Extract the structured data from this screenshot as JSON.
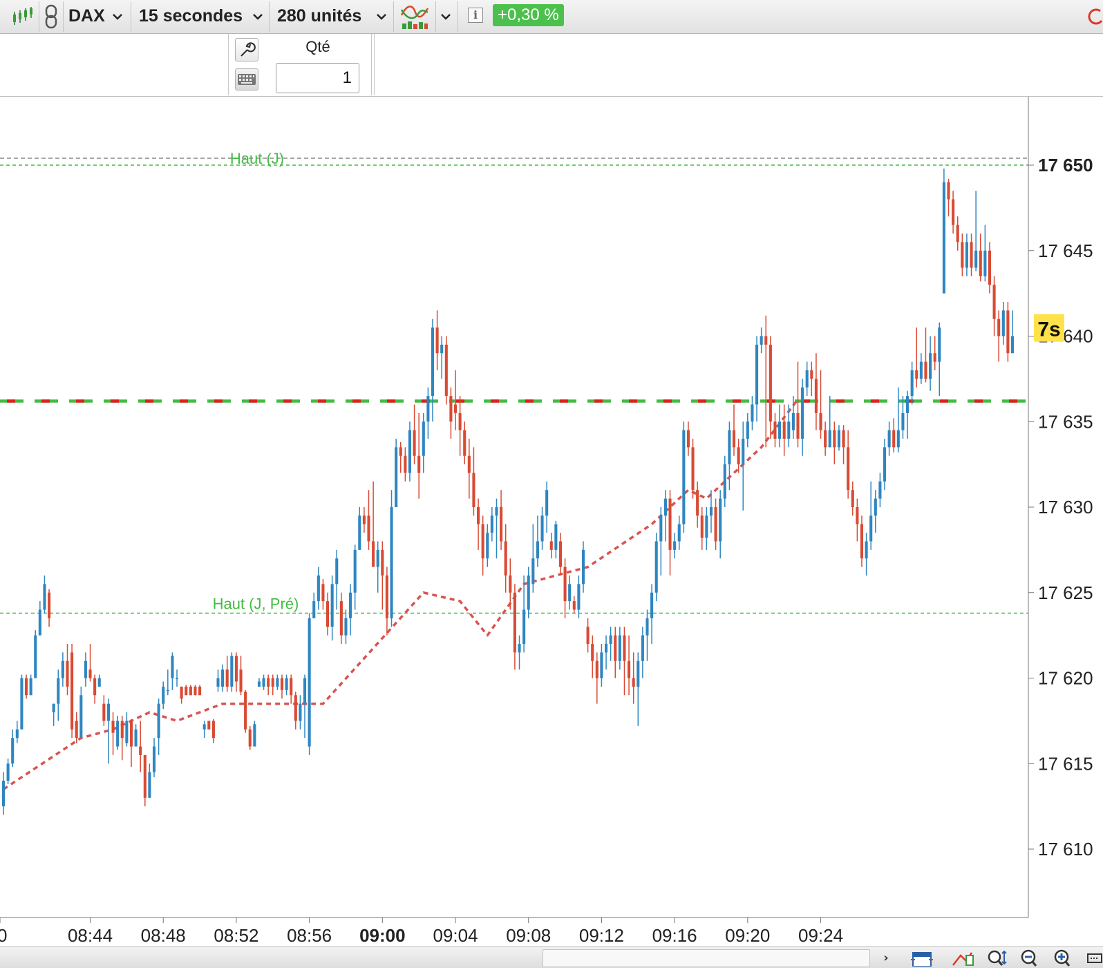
{
  "toolbar": {
    "instrument": "DAX",
    "interval": "15 secondes",
    "units": "280 unités",
    "change_badge": "+0,30 %",
    "badge_color": "#4cc04c"
  },
  "order_panel": {
    "qty_label": "Qté",
    "qty_value": "1"
  },
  "chart": {
    "timer_badge": "7s",
    "hline_labels": {
      "day_high": "Haut (J)",
      "prev_day_high": "Haut (J, Pré)"
    },
    "colors": {
      "up": "#2e86c1",
      "down": "#d94a33",
      "ma": "#d9534f",
      "level_green": "#44bb44",
      "level_red": "#e02020"
    }
  },
  "chart_data": {
    "type": "candlestick",
    "instrument": "DAX",
    "interval": "15 secondes",
    "ylim": [
      17606,
      17654
    ],
    "y_ticks": [
      "17 610",
      "17 615",
      "17 620",
      "17 625",
      "17 630",
      "17 635",
      "17 640",
      "17 645",
      "17 650"
    ],
    "x_ticks": [
      "0",
      "08:44",
      "08:48",
      "08:52",
      "08:56",
      "09:00",
      "09:04",
      "09:08",
      "09:12",
      "09:16",
      "09:20",
      "09:24"
    ],
    "x_tick_bold": "09:00",
    "hlines": [
      {
        "label": "Haut (J)",
        "value": 17650,
        "style": "dashed-green"
      },
      {
        "label": "",
        "value": 17650.2,
        "style": "dashed-grey"
      },
      {
        "label": "Haut (J, Pré)",
        "value": 17623.8,
        "style": "dashed-green"
      },
      {
        "label": "",
        "value": 17636.2,
        "style": "dashed-red-green"
      }
    ],
    "moving_average": [
      17613.5,
      17616.5,
      17617,
      17618,
      17617.5,
      17618.5,
      17618.5,
      17625,
      17624.5,
      17622.5,
      17625.5,
      17626.5,
      17629,
      17631,
      17630.5,
      17632,
      17633.5,
      17636.3
    ],
    "ma_index": [
      0,
      17,
      24,
      32,
      38,
      48,
      70,
      92,
      100,
      106,
      114,
      128,
      142,
      150,
      154,
      160,
      166,
      174
    ],
    "candles": [
      [
        17612.5,
        17614,
        17612,
        17614.5
      ],
      [
        17614,
        17615,
        17613.8,
        17615.3
      ],
      [
        17615,
        17616.5,
        17614.8,
        17617
      ],
      [
        17616.5,
        17617,
        17616.2,
        17617.5
      ],
      [
        17617,
        17620,
        17617,
        17620.2
      ],
      [
        17620,
        17619,
        17618.8,
        17620.2
      ],
      [
        17619,
        17620,
        17619,
        17620.2
      ],
      [
        17620,
        17622.5,
        17620,
        17622.8
      ],
      [
        17622.5,
        17624,
        17622.5,
        17624.5
      ],
      [
        17624,
        17625.5,
        17623.8,
        17626
      ],
      [
        17625,
        17623.5,
        17623,
        17625.2
      ],
      [
        17618,
        17618.5,
        17617.2,
        17618.5
      ],
      [
        17618.5,
        17620,
        17617.5,
        17620.5
      ],
      [
        17620,
        17621,
        17619.5,
        17621.5
      ],
      [
        17621,
        17619.5,
        17619,
        17622
      ],
      [
        17621.5,
        17617,
        17616.5,
        17622
      ],
      [
        17617.5,
        17616.5,
        17616.2,
        17618
      ],
      [
        17616.5,
        17619,
        17616.5,
        17619.5
      ],
      [
        17620,
        17621,
        17619.5,
        17621.5
      ],
      [
        17620.5,
        17620,
        17619.8,
        17622
      ],
      [
        17620,
        17619,
        17618.5,
        17620.2
      ],
      [
        17619.5,
        17620,
        17619.5,
        17620.2
      ],
      [
        17618.5,
        17617.5,
        17617.2,
        17619
      ],
      [
        17617.5,
        17618.5,
        17615,
        17618.8
      ],
      [
        17617.5,
        17616.8,
        17615.5,
        17618
      ],
      [
        17616,
        17617.5,
        17615.8,
        17617.8
      ],
      [
        17617.5,
        17616.5,
        17615.2,
        17617.8
      ],
      [
        17616.2,
        17617.5,
        17616,
        17618
      ],
      [
        17617.5,
        17616,
        17614.8,
        17617.6
      ],
      [
        17616,
        17617,
        17616,
        17617.3
      ],
      [
        17616,
        17615.5,
        17614.5,
        17617.5
      ],
      [
        17615.5,
        17613,
        17612.5,
        17615.5
      ],
      [
        17613,
        17614.5,
        17613,
        17615
      ],
      [
        17614.5,
        17616,
        17614.2,
        17616.5
      ],
      [
        17616.5,
        17618.5,
        17615.5,
        17618.8
      ],
      [
        17618.5,
        17619.5,
        17618.2,
        17619.8
      ],
      [
        17619.3,
        17619.3,
        17619,
        17620.5
      ],
      [
        17620,
        17621.3,
        17619.3,
        17621.5
      ],
      [
        17620,
        17620,
        17619.5,
        17620.5
      ],
      [
        17619.5,
        17618.8,
        17618.5,
        17619.5
      ],
      [
        17619.5,
        17619,
        17619,
        17619.6
      ],
      [
        17619.5,
        17619,
        17619,
        17619.6
      ],
      [
        17619.5,
        17619,
        17619,
        17619.6
      ],
      [
        17619.5,
        17619,
        17619,
        17619.6
      ],
      [
        17617,
        17617.3,
        17616.5,
        17617.5
      ],
      [
        17617.5,
        17617,
        17617,
        17617.5
      ],
      [
        17617.5,
        17616.5,
        17616.2,
        17617.6
      ],
      [
        17619.5,
        17620,
        17619.2,
        17620.5
      ],
      [
        17619.5,
        17620.5,
        17619.2,
        17620.8
      ],
      [
        17620.5,
        17619.5,
        17619.2,
        17621.3
      ],
      [
        17619.5,
        17621.3,
        17619.2,
        17621.5
      ],
      [
        17621.3,
        17619.8,
        17619.2,
        17621.5
      ],
      [
        17620.5,
        17619.2,
        17619,
        17621.3
      ],
      [
        17619.2,
        17617,
        17616.8,
        17619.3
      ],
      [
        17617,
        17616,
        17615.8,
        17617.2
      ],
      [
        17616,
        17617.3,
        17616,
        17617.5
      ],
      [
        17619.5,
        17619.8,
        17619.5,
        17620
      ],
      [
        17619.5,
        17620,
        17619.3,
        17620.2
      ],
      [
        17620,
        17619.5,
        17619,
        17620.2
      ],
      [
        17620,
        17619.5,
        17619,
        17620.2
      ],
      [
        17619.5,
        17620,
        17619.3,
        17620.2
      ],
      [
        17620,
        17619.3,
        17618.8,
        17620.2
      ],
      [
        17619.3,
        17620,
        17619,
        17620.2
      ],
      [
        17620,
        17619,
        17618.5,
        17620.2
      ],
      [
        17619,
        17617.5,
        17617,
        17619.2
      ],
      [
        17617.5,
        17618.5,
        17617,
        17619
      ],
      [
        17618.5,
        17620,
        17616.5,
        17620.2
      ],
      [
        17616,
        17623.5,
        17615.5,
        17623.8
      ],
      [
        17623.5,
        17624.5,
        17623.5,
        17625
      ],
      [
        17624.5,
        17626,
        17624,
        17626.5
      ],
      [
        17625.5,
        17624.5,
        17624,
        17625.8
      ],
      [
        17624.5,
        17623,
        17622.5,
        17625
      ],
      [
        17623,
        17625.5,
        17622.2,
        17626
      ],
      [
        17625.5,
        17627,
        17624,
        17627.5
      ],
      [
        17624.5,
        17622.5,
        17622,
        17625
      ],
      [
        17622.5,
        17623.5,
        17622,
        17624
      ],
      [
        17623.5,
        17625,
        17622.5,
        17625.5
      ],
      [
        17625,
        17627.5,
        17624,
        17627.8
      ],
      [
        17627.5,
        17629.5,
        17627.5,
        17630
      ],
      [
        17629.5,
        17629,
        17628.5,
        17630
      ],
      [
        17629.5,
        17628,
        17627.5,
        17631
      ],
      [
        17628,
        17626.5,
        17626.5,
        17631.5
      ],
      [
        17626.5,
        17627.5,
        17625,
        17628
      ],
      [
        17627.5,
        17626,
        17624,
        17628
      ],
      [
        17626,
        17623.5,
        17622.5,
        17626.5
      ],
      [
        17623.5,
        17630,
        17623,
        17631
      ],
      [
        17630,
        17633.5,
        17630,
        17634
      ],
      [
        17633.5,
        17633,
        17632,
        17633.8
      ],
      [
        17633,
        17632,
        17631.5,
        17633.5
      ],
      [
        17632,
        17634.5,
        17631.5,
        17635
      ],
      [
        17634.5,
        17633,
        17632.5,
        17636
      ],
      [
        17633,
        17632,
        17630.5,
        17635.5
      ],
      [
        17633,
        17635,
        17632,
        17635.5
      ],
      [
        17635,
        17636.5,
        17634,
        17637
      ],
      [
        17636.5,
        17640.5,
        17635,
        17641
      ],
      [
        17640.5,
        17639,
        17638,
        17641.5
      ],
      [
        17639,
        17639.5,
        17637.5,
        17640
      ],
      [
        17639.5,
        17636.5,
        17636,
        17640
      ],
      [
        17636.5,
        17635,
        17634,
        17637
      ],
      [
        17636,
        17635.5,
        17634.5,
        17638
      ],
      [
        17635.5,
        17634.5,
        17633,
        17636.5
      ],
      [
        17634.5,
        17633,
        17632.5,
        17635
      ],
      [
        17633,
        17632,
        17630.5,
        17634
      ],
      [
        17632,
        17630,
        17629.5,
        17633.5
      ],
      [
        17630,
        17629,
        17627.5,
        17630.5
      ],
      [
        17629,
        17627,
        17626,
        17629.5
      ],
      [
        17627,
        17628.5,
        17626.5,
        17629
      ],
      [
        17628.5,
        17629.5,
        17628,
        17630
      ],
      [
        17629.5,
        17630,
        17627,
        17630.5
      ],
      [
        17630,
        17628,
        17627.5,
        17631
      ],
      [
        17628,
        17626,
        17625,
        17629
      ],
      [
        17626,
        17625,
        17624,
        17627
      ],
      [
        17625,
        17621.5,
        17620.5,
        17625.5
      ],
      [
        17621.5,
        17622,
        17620.5,
        17622.5
      ],
      [
        17622,
        17624,
        17621.5,
        17626
      ],
      [
        17624,
        17626,
        17623.5,
        17626.5
      ],
      [
        17625.5,
        17627,
        17625,
        17629
      ],
      [
        17627,
        17628,
        17626.5,
        17629.5
      ],
      [
        17628,
        17629.5,
        17627.5,
        17630
      ],
      [
        17629.5,
        17631,
        17628.5,
        17631.5
      ],
      [
        17628,
        17627.5,
        17627,
        17628.5
      ],
      [
        17627.5,
        17629,
        17627,
        17629.2
      ],
      [
        17628,
        17626.5,
        17626,
        17628.5
      ],
      [
        17626.5,
        17624.5,
        17623.5,
        17627
      ],
      [
        17624.5,
        17625.5,
        17624,
        17626
      ],
      [
        17624.5,
        17624,
        17623.8,
        17624.8
      ],
      [
        17624,
        17625.5,
        17623.5,
        17626
      ],
      [
        17625.5,
        17627.5,
        17625,
        17628
      ],
      [
        17623,
        17622,
        17621.5,
        17623.5
      ],
      [
        17622,
        17621,
        17620,
        17622.5
      ],
      [
        17621,
        17620,
        17618.5,
        17621.5
      ],
      [
        17620,
        17621.5,
        17619.5,
        17622
      ],
      [
        17621.5,
        17622,
        17620.5,
        17622.5
      ],
      [
        17622,
        17622.5,
        17621,
        17623
      ],
      [
        17622.5,
        17621,
        17620,
        17623
      ],
      [
        17621,
        17622.5,
        17620.5,
        17623
      ],
      [
        17622.5,
        17621,
        17619,
        17623
      ],
      [
        17621,
        17620,
        17619,
        17622.5
      ],
      [
        17620,
        17619.5,
        17618.5,
        17621.5
      ],
      [
        17619.5,
        17621,
        17617.2,
        17621.5
      ],
      [
        17621,
        17622.5,
        17620,
        17623
      ],
      [
        17622.5,
        17623.5,
        17621,
        17624
      ],
      [
        17623.5,
        17625,
        17622,
        17625.5
      ],
      [
        17625,
        17628,
        17624.5,
        17628.5
      ],
      [
        17628,
        17629.5,
        17626,
        17630
      ],
      [
        17629.5,
        17630.5,
        17628,
        17631
      ],
      [
        17630.5,
        17627.5,
        17626,
        17631
      ],
      [
        17627.5,
        17628,
        17627,
        17628.5
      ]
    ],
    "candles_tail": [
      [
        17628,
        17629,
        17627.5,
        17629.5
      ],
      [
        17629,
        17634.5,
        17628.5,
        17635
      ],
      [
        17634.5,
        17633.5,
        17633,
        17635
      ],
      [
        17633.5,
        17631,
        17630.5,
        17634
      ],
      [
        17631,
        17629.5,
        17628.8,
        17631.5
      ],
      [
        17629.5,
        17628.2,
        17627.5,
        17630
      ],
      [
        17628.2,
        17629.5,
        17627.5,
        17630
      ],
      [
        17629.5,
        17630,
        17628.5,
        17631
      ],
      [
        17630,
        17628,
        17627.5,
        17630.5
      ],
      [
        17628,
        17630.5,
        17627,
        17631
      ],
      [
        17630.5,
        17632.5,
        17630,
        17633
      ],
      [
        17632.5,
        17634.5,
        17631,
        17635
      ],
      [
        17634.5,
        17633.5,
        17633,
        17636
      ],
      [
        17633.5,
        17632.5,
        17632,
        17634
      ],
      [
        17632.5,
        17634,
        17629.8,
        17635
      ],
      [
        17634,
        17635,
        17633.5,
        17635.5
      ],
      [
        17635,
        17636,
        17634.5,
        17636.5
      ],
      [
        17636,
        17639.5,
        17635,
        17640
      ],
      [
        17639.5,
        17640,
        17639,
        17640.5
      ],
      [
        17640,
        17639.5,
        17633.5,
        17641.2
      ],
      [
        17639.5,
        17635,
        17634,
        17640
      ],
      [
        17635,
        17634,
        17633.5,
        17635.5
      ],
      [
        17634,
        17635,
        17633.5,
        17636
      ],
      [
        17635,
        17634,
        17633,
        17636
      ],
      [
        17634,
        17635,
        17633.5,
        17636
      ],
      [
        17634.5,
        17635.5,
        17634,
        17636.5
      ],
      [
        17635.5,
        17634,
        17633.5,
        17638.5
      ],
      [
        17634,
        17637,
        17633,
        17637.5
      ],
      [
        17637,
        17638,
        17636.5,
        17638.5
      ],
      [
        17638,
        17637.5,
        17636.5,
        17638.5
      ],
      [
        17637.5,
        17635.5,
        17634.5,
        17639
      ],
      [
        17635.5,
        17634.5,
        17634,
        17638
      ],
      [
        17634.5,
        17633.5,
        17633,
        17635
      ],
      [
        17633.5,
        17634.5,
        17633.5,
        17636.5
      ],
      [
        17634.5,
        17633.5,
        17632.5,
        17635
      ],
      [
        17633.5,
        17634.5,
        17633.3,
        17634.8
      ],
      [
        17634.5,
        17633.5,
        17632.5,
        17634.8
      ],
      [
        17633.5,
        17631,
        17630.5,
        17634.5
      ],
      [
        17631,
        17630,
        17629.5,
        17631.5
      ],
      [
        17630,
        17629,
        17628,
        17630.5
      ],
      [
        17629,
        17627,
        17626.5,
        17629.5
      ],
      [
        17627,
        17628,
        17626,
        17628.5
      ],
      [
        17628,
        17629.5,
        17627.5,
        17631.5
      ],
      [
        17629.5,
        17630.5,
        17628.5,
        17631
      ],
      [
        17630.5,
        17631.5,
        17630,
        17632
      ],
      [
        17631.5,
        17633.5,
        17631,
        17634
      ],
      [
        17633.5,
        17634.5,
        17633,
        17635
      ],
      [
        17634.5,
        17633.5,
        17633.2,
        17635.2
      ],
      [
        17633.5,
        17634.5,
        17633.2,
        17637
      ],
      [
        17634.5,
        17635.5,
        17634,
        17636.5
      ],
      [
        17635.5,
        17636.5,
        17634,
        17636.8
      ],
      [
        17636.5,
        17638,
        17636,
        17638.5
      ],
      [
        17638,
        17637.5,
        17637,
        17640.5
      ],
      [
        17637.5,
        17638.5,
        17637.2,
        17639
      ],
      [
        17638.5,
        17637.5,
        17637.3,
        17640.5
      ],
      [
        17637.5,
        17639,
        17636.8,
        17640
      ],
      [
        17639,
        17638.5,
        17638,
        17640
      ],
      [
        17638.5,
        17640.5,
        17636.5,
        17640.8
      ],
      [
        17642.5,
        17649,
        17642.5,
        17649.8
      ],
      [
        17649,
        17648,
        17647,
        17649.2
      ],
      [
        17648,
        17646.5,
        17646,
        17648.5
      ],
      [
        17646.5,
        17645.5,
        17645,
        17647
      ],
      [
        17645.5,
        17644,
        17643.5,
        17646
      ],
      [
        17644,
        17645.5,
        17643.5,
        17646
      ],
      [
        17645.5,
        17644,
        17643.5,
        17646
      ],
      [
        17644,
        17645,
        17643.8,
        17648.5
      ],
      [
        17645,
        17643.5,
        17643.2,
        17646
      ],
      [
        17643.5,
        17645,
        17643.2,
        17646.5
      ],
      [
        17645,
        17643,
        17642.5,
        17645.5
      ],
      [
        17643,
        17641,
        17640,
        17643.5
      ],
      [
        17641,
        17640,
        17638.5,
        17641.5
      ],
      [
        17640,
        17641.5,
        17639.5,
        17642
      ],
      [
        17641.5,
        17639,
        17638.5,
        17642
      ],
      [
        17639,
        17640,
        17639,
        17641.5
      ]
    ]
  }
}
